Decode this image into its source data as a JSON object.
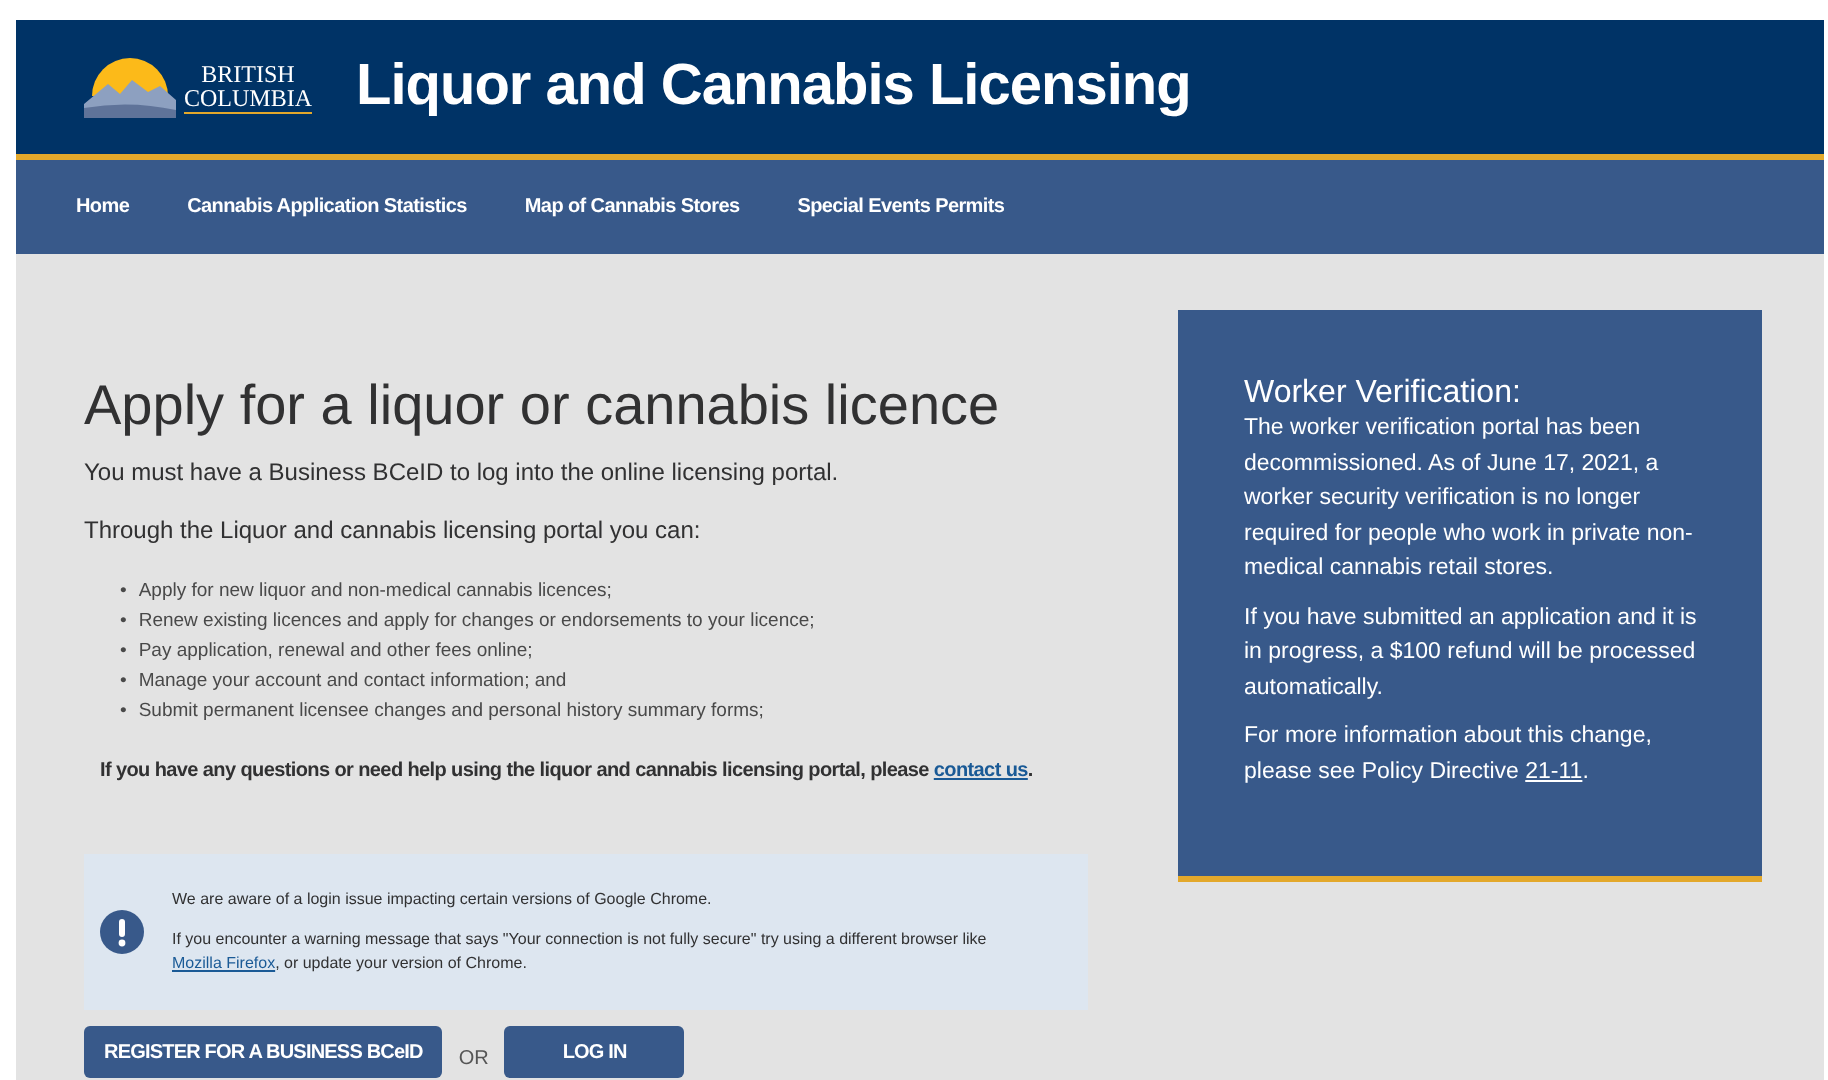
{
  "header": {
    "logo_lines": [
      "BRITISH",
      "COLUMBIA"
    ],
    "title": "Liquor and Cannabis Licensing"
  },
  "nav": [
    {
      "label": "Home"
    },
    {
      "label": "Cannabis Application Statistics"
    },
    {
      "label": "Map of Cannabis Stores"
    },
    {
      "label": "Special Events Permits"
    }
  ],
  "main": {
    "heading": "Apply for a liquor or cannabis licence",
    "intro": "You must have a Business BCeID to log into the online licensing portal.",
    "lead": "Through the Liquor and cannabis licensing portal you can:",
    "bullet_marker": "•",
    "bullets": [
      "Apply for new liquor and non-medical cannabis licences;",
      "Renew existing licences and apply for changes or endorsements to your licence;",
      "Pay application, renewal and other fees online;",
      "Manage your account and contact information; and",
      "Submit permanent licensee changes and personal history summary forms;"
    ],
    "help": {
      "before": "If you have any questions or need help using the liquor and cannabis licensing portal, please ",
      "link": "contact us",
      "after": "."
    },
    "alert": {
      "line1": "We are aware of a login issue impacting certain versions of Google Chrome.",
      "before": "If you encounter a warning message that says \"Your connection is not fully secure\" try using a different browser like ",
      "link": "Mozilla Firefox",
      "after": ", or update your version of Chrome."
    },
    "register_button": "REGISTER FOR A BUSINESS BCeID",
    "or": "OR",
    "login_button": "LOG IN"
  },
  "panel": {
    "title": "Worker Verification:",
    "para1": "The worker verification portal has been decommissioned. As of June 17, 2021, a worker security verification is no longer required for people who work in private non-medical cannabis retail stores.",
    "para2": "If you have submitted an application and it is in progress, a $100 refund will be processed automatically.",
    "para3": {
      "before": "For more information about this change, please see Policy Directive ",
      "link": "21-11",
      "after": "."
    }
  }
}
